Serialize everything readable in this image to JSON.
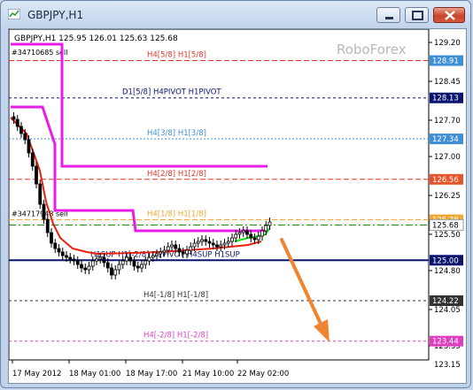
{
  "window": {
    "title": "GBPJPY,H1"
  },
  "header": {
    "symbol": "GBPJPY,H1",
    "ohlc": "125.95 126.01 125.63 125.68"
  },
  "watermark": "RoboForex",
  "price_axis": {
    "ticks": [
      "129.20",
      "128.45",
      "127.70",
      "127.00",
      "126.25",
      "125.50",
      "124.80",
      "124.05",
      "123.35"
    ],
    "bottom_tick": "123.15"
  },
  "time_axis": {
    "labels": [
      "17 May 2012",
      "18 May 01:00",
      "18 May 17:00",
      "21 May 10:00",
      "22 May 02:00"
    ]
  },
  "levels": [
    {
      "text": "H4[5/8] H1[5/8]",
      "price": 128.85,
      "badge": "128.91",
      "color": "#e8342a",
      "badge_color": "#3f8fd6"
    },
    {
      "text": "D1[5/8] H4PIVOT H1PIVOT",
      "price": 128.13,
      "badge": "128.13",
      "color": "#0b1570",
      "badge_color": "#0b1570"
    },
    {
      "text": "H4[3/8] H1[3/8]",
      "price": 127.34,
      "badge": "127.34",
      "color": "#3f8fd6",
      "badge_color": "#3f8fd6"
    },
    {
      "text": "H4[2/8] H1[2/8]",
      "price": 126.56,
      "badge": "126.56",
      "color": "#e8342a",
      "badge_color": "#e8542a"
    },
    {
      "text": "H4[1/8] H1[1/8]",
      "price": 125.78,
      "badge": "125.78",
      "color": "#f0a830",
      "badge_color": "#f0a830"
    },
    {
      "text": "H1SUP H1[-2/8] D1PIVOT H4SUP H1SUP",
      "price": 125.0,
      "badge": "125.00",
      "color": "#0b1570",
      "badge_color": "#0b1570"
    },
    {
      "text": "H4[-1/8] H1[-1/8]",
      "price": 124.22,
      "badge": "124.22",
      "color": "#333333",
      "badge_color": "#333333"
    },
    {
      "text": "H4[-2/8] H1[-2/8]",
      "price": 123.44,
      "badge": "123.44",
      "color": "#e040c0",
      "badge_color": "#e040c0"
    }
  ],
  "orders": [
    {
      "text": "#34710685 sell",
      "price": 128.91
    },
    {
      "text": "#34717948 sell",
      "price": 125.8
    }
  ],
  "current_price": {
    "badge": "125.68",
    "price": 125.68
  },
  "colors": {
    "magenta_line": "#e81ee8",
    "red_line": "#e8200c",
    "green_line": "#10e010",
    "arrow": "#f08530"
  }
}
